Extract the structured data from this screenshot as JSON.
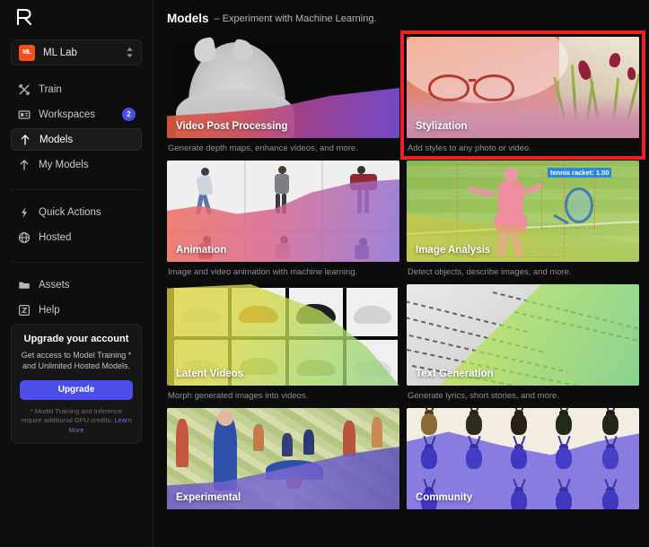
{
  "sidebar": {
    "logo_icon": "runway-logo-icon",
    "workspace": {
      "avatar_text": "ML",
      "name": "ML Lab",
      "chevron_icon": "chevron-up-down-icon"
    },
    "nav_primary": [
      {
        "label": "Train",
        "icon": "train-icon",
        "active": false,
        "badge": ""
      },
      {
        "label": "Workspaces",
        "icon": "workspaces-icon",
        "active": false,
        "badge": "2"
      },
      {
        "label": "Models",
        "icon": "models-icon",
        "active": true,
        "badge": ""
      },
      {
        "label": "My Models",
        "icon": "my-models-icon",
        "active": false,
        "badge": ""
      }
    ],
    "nav_secondary": [
      {
        "label": "Quick Actions",
        "icon": "lightning-icon"
      },
      {
        "label": "Hosted",
        "icon": "globe-icon"
      }
    ],
    "nav_tertiary": [
      {
        "label": "Assets",
        "icon": "folder-icon"
      },
      {
        "label": "Help",
        "icon": "help-icon"
      }
    ],
    "upgrade": {
      "title": "Upgrade your account",
      "subtitle": "Get access to Model Training * and Unlimited Hosted Models.",
      "button_label": "Upgrade",
      "note": "* Model Training and Inference require additional GPU credits.",
      "note_link": "Learn More"
    }
  },
  "header": {
    "title": "Models",
    "subtitle": "– Experiment with Machine Learning."
  },
  "cards": [
    {
      "title": "Video Post Processing",
      "description": "Generate depth maps, enhance videos, and more.",
      "art": "video-post-processing",
      "highlighted": false
    },
    {
      "title": "Stylization",
      "description": "Add styles to any photo or video.",
      "art": "stylization",
      "highlighted": true
    },
    {
      "title": "Animation",
      "description": "Image and video animation with machine learning.",
      "art": "animation",
      "highlighted": false
    },
    {
      "title": "Image Analysis",
      "description": "Detect objects, describe images, and more.",
      "art": "image-analysis",
      "detection_label": "tennis racket: 1.00",
      "highlighted": false
    },
    {
      "title": "Latent Videos",
      "description": "Morph generated images into videos.",
      "art": "latent-videos",
      "highlighted": false
    },
    {
      "title": "Text Generation",
      "description": "Generate lyrics, short stories, and more.",
      "art": "text-generation",
      "highlighted": false
    },
    {
      "title": "Experimental",
      "description": "",
      "art": "experimental",
      "highlighted": false
    },
    {
      "title": "Community",
      "description": "",
      "art": "community",
      "highlighted": false
    }
  ],
  "colors": {
    "accent": "#4b4ee8",
    "highlight_border": "#ef2020",
    "avatar": "#f4501e",
    "background": "#0c0c0d",
    "sidebar_background": "#0e0e0f"
  }
}
